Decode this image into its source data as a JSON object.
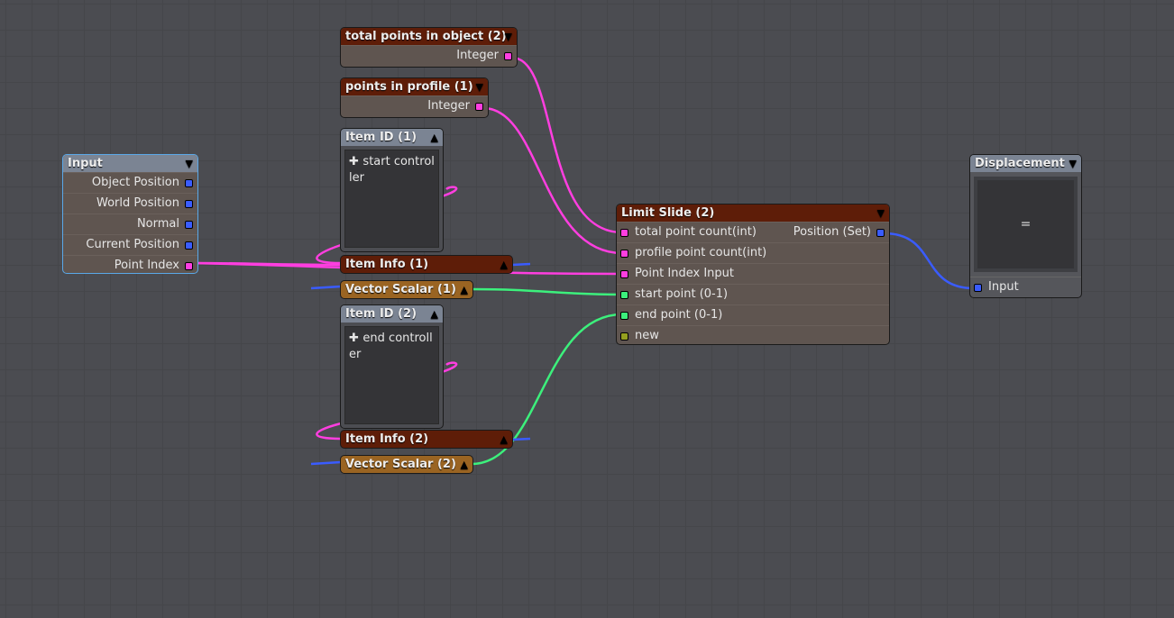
{
  "colors": {
    "integer": "#ff3ee0",
    "vector": "#3a5cff",
    "float": "#3cf07c",
    "new": "#95a020",
    "header_brown": "#5e1d08",
    "header_gold": "#9a6422",
    "header_slate": "#7b8493",
    "selected_border": "#5aa8e8"
  },
  "nodes": {
    "total_points": {
      "title": "total points in object (2)",
      "output": "Integer"
    },
    "points_profile": {
      "title": "points in profile (1)",
      "output": "Integer"
    },
    "item_id_1": {
      "title": "Item ID (1)",
      "text": "start controller"
    },
    "item_info_1": {
      "title": "Item Info (1)"
    },
    "vector_scalar_1": {
      "title": "Vector Scalar (1)"
    },
    "item_id_2": {
      "title": "Item ID (2)",
      "text": "end controller"
    },
    "item_info_2": {
      "title": "Item Info (2)"
    },
    "vector_scalar_2": {
      "title": "Vector Scalar (2)"
    },
    "input": {
      "title": "Input",
      "outputs": [
        "Object Position",
        "World Position",
        "Normal",
        "Current Position",
        "Point Index"
      ]
    },
    "limit_slide": {
      "title": "Limit Slide (2)",
      "inputs": [
        "total point count(int)",
        "profile point count(int)",
        "Point Index Input",
        "start point (0-1)",
        "end point (0-1)",
        "new"
      ],
      "output": "Position (Set)"
    },
    "displacement": {
      "title": "Displacement",
      "preview": "=",
      "input": "Input"
    }
  },
  "icons": {
    "collapse": "chevron-down-icon",
    "expand": "chevron-up-icon",
    "add": "plus-icon"
  }
}
